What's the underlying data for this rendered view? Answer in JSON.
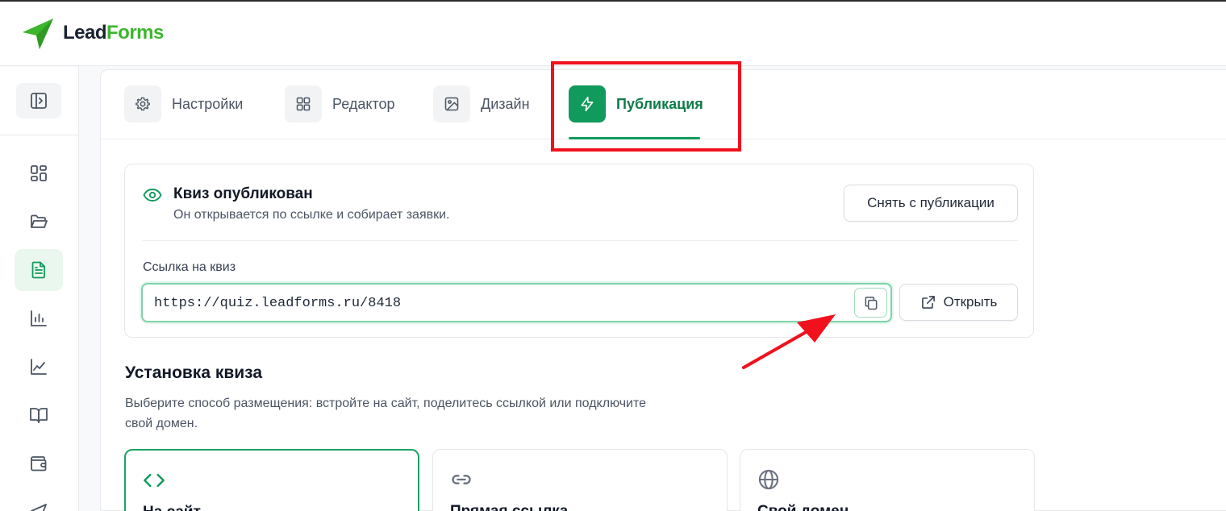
{
  "app": {
    "logo_lead": "Lead",
    "logo_forms": "Forms"
  },
  "colors": {
    "brand_green": "#3cb62e",
    "accent": "#109a5b",
    "highlight_red": "#f0111d"
  },
  "sidebar": {
    "items": [
      {
        "icon": "dashboard-icon"
      },
      {
        "icon": "folder-icon"
      },
      {
        "icon": "document-icon",
        "active": true
      },
      {
        "icon": "bar-chart-icon"
      },
      {
        "icon": "line-chart-icon"
      },
      {
        "icon": "book-icon"
      },
      {
        "icon": "wallet-icon"
      },
      {
        "icon": "send-icon"
      }
    ]
  },
  "tabs": [
    {
      "label": "Настройки",
      "icon": "gear-icon"
    },
    {
      "label": "Редактор",
      "icon": "grid-icon"
    },
    {
      "label": "Дизайн",
      "icon": "image-icon"
    },
    {
      "label": "Публикация",
      "icon": "lightning-icon",
      "active": true
    }
  ],
  "publish": {
    "title": "Квиз опубликован",
    "subtitle": "Он открывается по ссылке и собирает заявки.",
    "unpublish_label": "Снять с публикации",
    "link_label": "Ссылка на квиз",
    "link_value": "https://quiz.leadforms.ru/8418",
    "open_label": "Открыть"
  },
  "install": {
    "title": "Установка квиза",
    "description": "Выберите способ размещения: встройте на сайт, поделитесь ссылкой или подключите свой домен.",
    "options": [
      {
        "title": "На сайт",
        "icon": "code-icon",
        "selected": true
      },
      {
        "title": "Прямая ссылка",
        "icon": "link-icon"
      },
      {
        "title": "Свой домен",
        "icon": "globe-icon"
      }
    ]
  }
}
